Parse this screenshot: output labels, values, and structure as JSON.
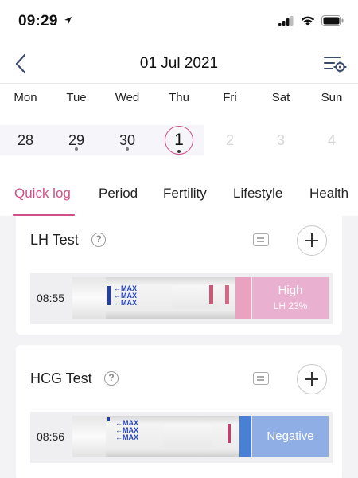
{
  "status_bar": {
    "time": "09:29",
    "icons": [
      "location-arrow-icon",
      "cellular-signal-icon",
      "wifi-icon",
      "battery-icon"
    ]
  },
  "header": {
    "title": "01 Jul 2021",
    "back_icon": "chevron-left-icon",
    "settings_icon": "list-settings-icon"
  },
  "week": {
    "days": [
      {
        "label": "Mon",
        "date": "28",
        "has_log": false,
        "future": false
      },
      {
        "label": "Tue",
        "date": "29",
        "has_log": true,
        "future": false
      },
      {
        "label": "Wed",
        "date": "30",
        "has_log": true,
        "future": false
      },
      {
        "label": "Thu",
        "date": "1",
        "has_log": true,
        "future": false,
        "today": true
      },
      {
        "label": "Fri",
        "date": "2",
        "has_log": false,
        "future": true
      },
      {
        "label": "Sat",
        "date": "3",
        "has_log": false,
        "future": true
      },
      {
        "label": "Sun",
        "date": "4",
        "has_log": false,
        "future": true
      }
    ]
  },
  "tabs": [
    {
      "label": "Quick log",
      "active": true
    },
    {
      "label": "Period",
      "active": false
    },
    {
      "label": "Fertility",
      "active": false
    },
    {
      "label": "Lifestyle",
      "active": false
    },
    {
      "label": "Health",
      "active": false
    }
  ],
  "cards": {
    "lh": {
      "title": "LH Test",
      "help": "?",
      "result": {
        "time": "08:55",
        "strip_text": [
          "MAX",
          "MAX"
        ],
        "label": "High",
        "detail": "LH 23%"
      }
    },
    "hcg": {
      "title": "HCG Test",
      "help": "?",
      "result": {
        "time": "08:56",
        "strip_text": [
          "MAX",
          "MAX"
        ],
        "label": "Negative"
      }
    }
  },
  "colors": {
    "accent": "#d0508a",
    "high_badge": "#eab0cf",
    "negative_badge": "#8faee6",
    "content_bg": "#f3f3f5"
  }
}
